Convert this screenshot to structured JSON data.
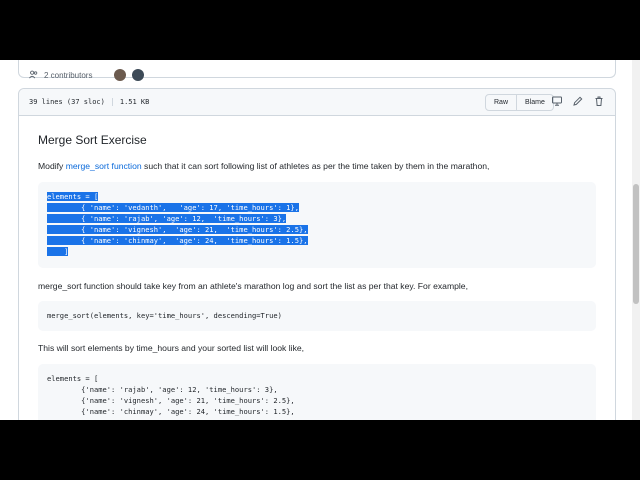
{
  "contributors": {
    "label": "2 contributors"
  },
  "file": {
    "lines": "39 lines (37 sloc)",
    "size": "1.51 KB",
    "raw_label": "Raw",
    "blame_label": "Blame"
  },
  "readme": {
    "title": "Merge Sort Exercise",
    "intro_prefix": "Modify ",
    "intro_link": "merge_sort function",
    "intro_suffix": " such that it can sort following list of athletes as per the time taken by them in the marathon,",
    "code1": [
      "elements = [",
      "        { 'name': 'vedanth',   'age': 17, 'time_hours': 1},",
      "        { 'name': 'rajab', 'age': 12,  'time_hours': 3},",
      "        { 'name': 'vignesh',  'age': 21,  'time_hours': 2.5},",
      "        { 'name': 'chinmay',  'age': 24,  'time_hours': 1.5},",
      "    ]"
    ],
    "para2": "merge_sort function should take key from an athlete's marathon log and sort the list as per that key. For example,",
    "code2": "merge_sort(elements, key='time_hours', descending=True)",
    "para3": "This will sort elements by time_hours and your sorted list will look like,",
    "code3": [
      "elements = [",
      "        {'name': 'rajab', 'age': 12, 'time_hours': 3},",
      "        {'name': 'vignesh', 'age': 21, 'time_hours': 2.5},",
      "        {'name': 'chinmay', 'age': 24, 'time_hours': 1.5},"
    ]
  }
}
